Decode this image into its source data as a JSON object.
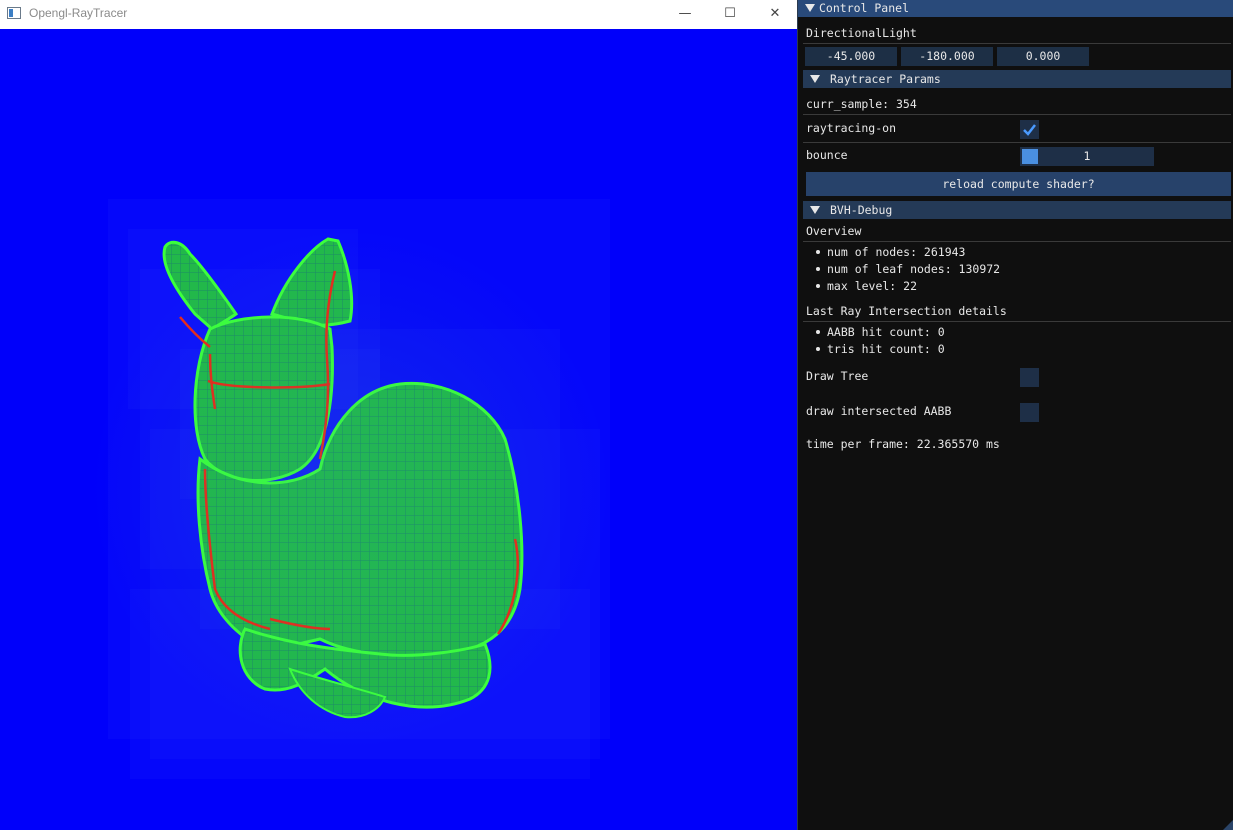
{
  "window": {
    "title": "Opengl-RayTracer",
    "minimize_glyph": "—",
    "maximize_glyph": "☐",
    "close_glyph": "✕"
  },
  "viewport": {
    "background_color": "#0000fa",
    "mesh_color": "#2fe02f",
    "edge_color": "#e82a1a"
  },
  "panel": {
    "title": "Control Panel",
    "directional_light": {
      "label": "DirectionalLight",
      "values": [
        "-45.000",
        "-180.000",
        "0.000"
      ]
    },
    "raytracer": {
      "header": "Raytracer Params",
      "curr_sample": "curr_sample: 354",
      "raytracing_label": "raytracing-on",
      "raytracing_checked": true,
      "bounce_label": "bounce",
      "bounce_value": "1",
      "reload_button": "reload compute shader?"
    },
    "bvh": {
      "header": "BVH-Debug",
      "overview_label": "Overview",
      "overview_items": [
        "num of nodes: 261943",
        "num of leaf nodes: 130972",
        "max level: 22"
      ],
      "intersection_label": "Last Ray Intersection details",
      "intersection_items": [
        "AABB hit count: 0",
        "tris hit count: 0"
      ],
      "draw_tree_label": "Draw Tree",
      "draw_tree_checked": false,
      "draw_aabb_label": "draw intersected AABB",
      "draw_aabb_checked": false,
      "time_per_frame": "time per frame: 22.365570 ms"
    }
  }
}
